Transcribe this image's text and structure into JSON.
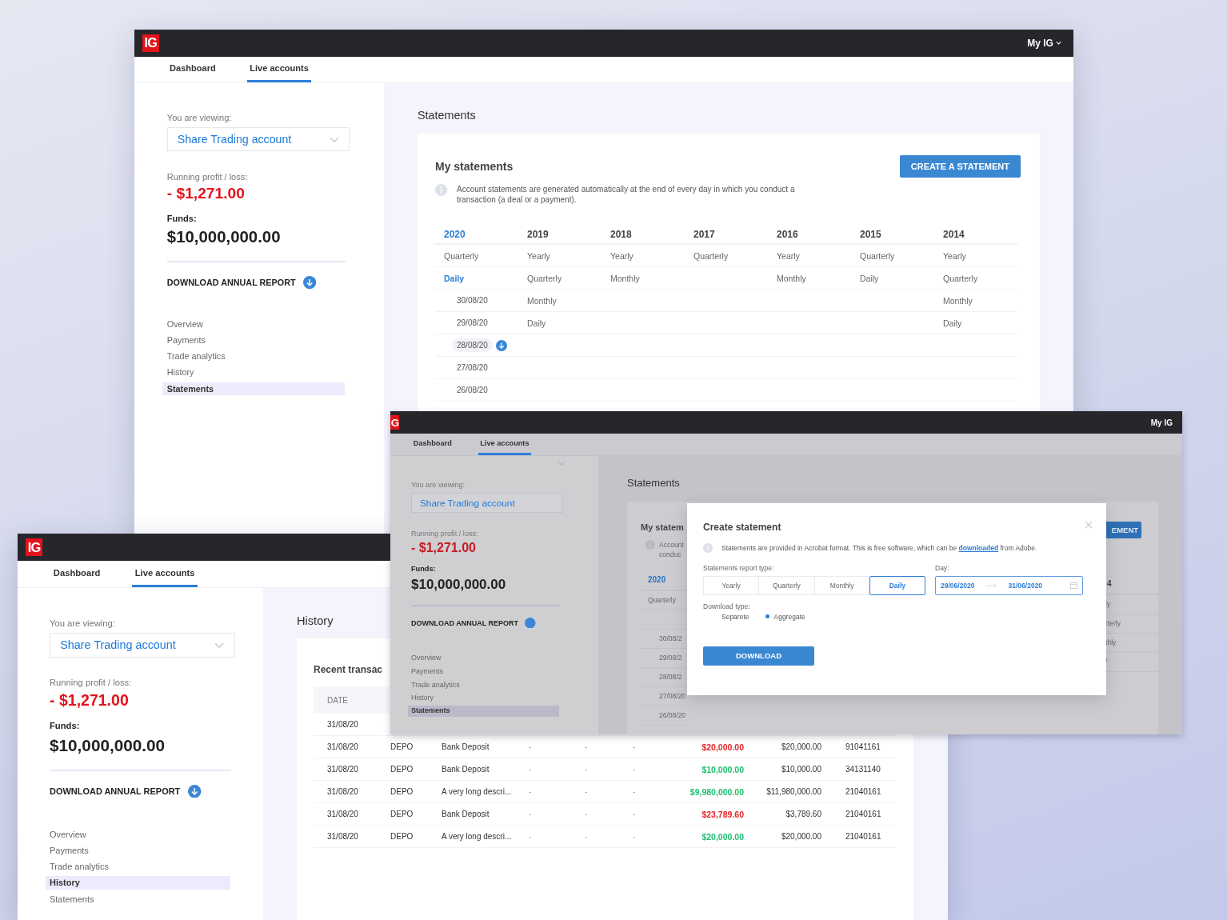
{
  "windows": [
    {
      "kind": "statements",
      "topbar": {
        "logo": "IG",
        "menu": {
          "label": "My IG",
          "caret": true
        }
      },
      "tabs": [
        {
          "label": "Dashboard",
          "selected": false
        },
        {
          "label": "Live accounts",
          "selected": true
        }
      ],
      "sidebar": {
        "viewing_label": "You are viewing:",
        "account": "Share Trading account",
        "profit_label": "Running profit / loss:",
        "profit": "- $1,271.00",
        "funds_label": "Funds:",
        "funds": "$10,000,000.00",
        "report_link": "DOWNLOAD ANNUAL REPORT",
        "nav": [
          {
            "label": "Overview",
            "selected": false
          },
          {
            "label": "Payments",
            "selected": false
          },
          {
            "label": "Trade analytics",
            "selected": false
          },
          {
            "label": "History",
            "selected": false
          },
          {
            "label": "Statements",
            "selected": true
          }
        ]
      },
      "main": {
        "title": "Statements",
        "card": {
          "heading": "My statements",
          "button": "CREATE A STATEMENT",
          "info": "Account statements are generated automatically at the end of every day in which you conduct a transaction (a deal or a payment).",
          "years": [
            {
              "label": "2020",
              "selected": true,
              "periods": [
                {
                  "label": "Quarterly",
                  "selected": false
                },
                {
                  "label": "Daily",
                  "selected": true,
                  "children": [
                    {
                      "label": "30/08/20",
                      "selected": false
                    },
                    {
                      "label": "29/08/20",
                      "selected": false
                    },
                    {
                      "label": "28/08/20",
                      "selected": true
                    },
                    {
                      "label": "27/08/20",
                      "selected": false
                    },
                    {
                      "label": "26/08/20",
                      "selected": false
                    }
                  ]
                }
              ]
            },
            {
              "label": "2019",
              "selected": false,
              "periods": [
                {
                  "label": "Yearly",
                  "selected": false
                },
                {
                  "label": "Quarterly",
                  "selected": false
                },
                {
                  "label": "Monthly",
                  "selected": false
                },
                {
                  "label": "Daily",
                  "selected": false
                }
              ]
            },
            {
              "label": "2018",
              "selected": false,
              "periods": [
                {
                  "label": "Yearly",
                  "selected": false
                },
                {
                  "label": "Monthly",
                  "selected": false
                }
              ]
            },
            {
              "label": "2017",
              "selected": false,
              "periods": [
                {
                  "label": "Quarterly",
                  "selected": false
                }
              ]
            },
            {
              "label": "2016",
              "selected": false,
              "periods": [
                {
                  "label": "Yearly",
                  "selected": false
                },
                {
                  "label": "Monthly",
                  "selected": false
                }
              ]
            },
            {
              "label": "2015",
              "selected": false,
              "periods": [
                {
                  "label": "Quarterly",
                  "selected": false
                },
                {
                  "label": "Daily",
                  "selected": false
                }
              ]
            },
            {
              "label": "2014",
              "selected": false,
              "periods": [
                {
                  "label": "Yearly",
                  "selected": false
                },
                {
                  "label": "Quarterly",
                  "selected": false
                },
                {
                  "label": "Monthly",
                  "selected": false
                },
                {
                  "label": "Daily",
                  "selected": false
                }
              ]
            }
          ]
        }
      }
    },
    {
      "kind": "statement_dialog",
      "topbar": {
        "logo": "G",
        "menu": {
          "label": "My IG",
          "caret": false
        }
      },
      "tabs": [
        {
          "label": "Dashboard",
          "selected": false
        },
        {
          "label": "Live accounts",
          "selected": true
        }
      ],
      "sidebar": {
        "viewing_label": "You are viewing:",
        "account": "Share Trading account",
        "profit_label": "Running profit / loss:",
        "profit": "- $1,271.00",
        "funds_label": "Funds:",
        "funds": "$10,000,000.00",
        "report_link": "DOWNLOAD ANNUAL REPORT",
        "nav": [
          {
            "label": "Overview",
            "selected": false
          },
          {
            "label": "Payments",
            "selected": false
          },
          {
            "label": "Trade analytics",
            "selected": false
          },
          {
            "label": "History",
            "selected": false
          },
          {
            "label": "Statements",
            "selected": true
          }
        ]
      },
      "main": {
        "title": "Statements",
        "card": {
          "heading": "My statem",
          "info_lines": [
            "Account",
            "conduc"
          ],
          "year": "2020",
          "periods": [
            "Quarterly"
          ],
          "dates": [
            "30/08/2",
            "29/08/2",
            "28/08/2",
            "27/08/20",
            "26/08/20"
          ],
          "button": "EMENT",
          "right_year": "4",
          "right_periods": [
            "ly",
            "rterly",
            "thly",
            "/"
          ]
        },
        "dialog": {
          "title": "Create statement",
          "info_before": "Statements are provided in Acrobat format. This is free software, which can be ",
          "info_link": "downloaded",
          "info_after": " from Adobe.",
          "report_type_label": "Statements report type:",
          "report_types": [
            {
              "label": "Yearly",
              "selected": false
            },
            {
              "label": "Quarterly",
              "selected": false
            },
            {
              "label": "Monthly",
              "selected": false
            },
            {
              "label": "Daily",
              "selected": true
            }
          ],
          "day_label": "Day:",
          "date_from": "29/06/2020",
          "date_to": "31/06/2020",
          "download_type_label": "Download type:",
          "download_types": [
            {
              "label": "Separete",
              "selected": false
            },
            {
              "label": "Aggregate",
              "selected": true
            }
          ],
          "button": "DOWNLOAD"
        }
      }
    },
    {
      "kind": "history",
      "topbar": {
        "logo": "IG"
      },
      "tabs": [
        {
          "label": "Dashboard",
          "selected": false
        },
        {
          "label": "Live accounts",
          "selected": true
        }
      ],
      "sidebar": {
        "viewing_label": "You are viewing:",
        "account": "Share Trading account",
        "profit_label": "Running profit / loss:",
        "profit": "- $1,271.00",
        "funds_label": "Funds:",
        "funds": "$10,000,000.00",
        "report_link": "DOWNLOAD ANNUAL REPORT",
        "nav": [
          {
            "label": "Overview",
            "selected": false
          },
          {
            "label": "Payments",
            "selected": false
          },
          {
            "label": "Trade analytics",
            "selected": false
          },
          {
            "label": "History",
            "selected": true
          },
          {
            "label": "Statements",
            "selected": false
          }
        ]
      },
      "main": {
        "title": "History",
        "card": {
          "heading": "Recent transac",
          "columns": [
            "DATE"
          ],
          "rows": [
            {
              "date": "31/08/20"
            },
            {
              "date": "31/08/20",
              "type": "DEPO",
              "description": "Bank Deposit",
              "column_4": "-",
              "column_5": "-",
              "column_6": "-",
              "amount": "$20,000.00",
              "color": "#e3262b",
              "balance": "$20,000.00",
              "reference": "91041161"
            },
            {
              "date": "31/08/20",
              "type": "DEPO",
              "description": "Bank Deposit",
              "column_4": "-",
              "column_5": "-",
              "column_6": "-",
              "amount": "$10,000.00",
              "color": "#1fbf6e",
              "balance": "$10,000.00",
              "reference": "34131140"
            },
            {
              "date": "31/08/20",
              "type": "DEPO",
              "description": "A very long descri...",
              "column_4": "-",
              "column_5": "-",
              "column_6": "-",
              "amount": "$9,980,000.00",
              "color": "#1fbf6e",
              "balance": "$11,980,000.00",
              "reference": "21040161"
            },
            {
              "date": "31/08/20",
              "type": "DEPO",
              "description": "Bank Deposit",
              "column_4": "-",
              "column_5": "-",
              "column_6": "-",
              "amount": "$23,789.60",
              "color": "#e3262b",
              "balance": "$3,789.60",
              "reference": "21040161"
            },
            {
              "date": "31/08/20",
              "type": "DEPO",
              "description": "A very long descri...",
              "column_4": "-",
              "column_5": "-",
              "column_6": "-",
              "amount": "$20,000.00",
              "color": "#1fbf6e",
              "balance": "$20,000.00",
              "reference": "21040161"
            }
          ]
        }
      }
    }
  ]
}
